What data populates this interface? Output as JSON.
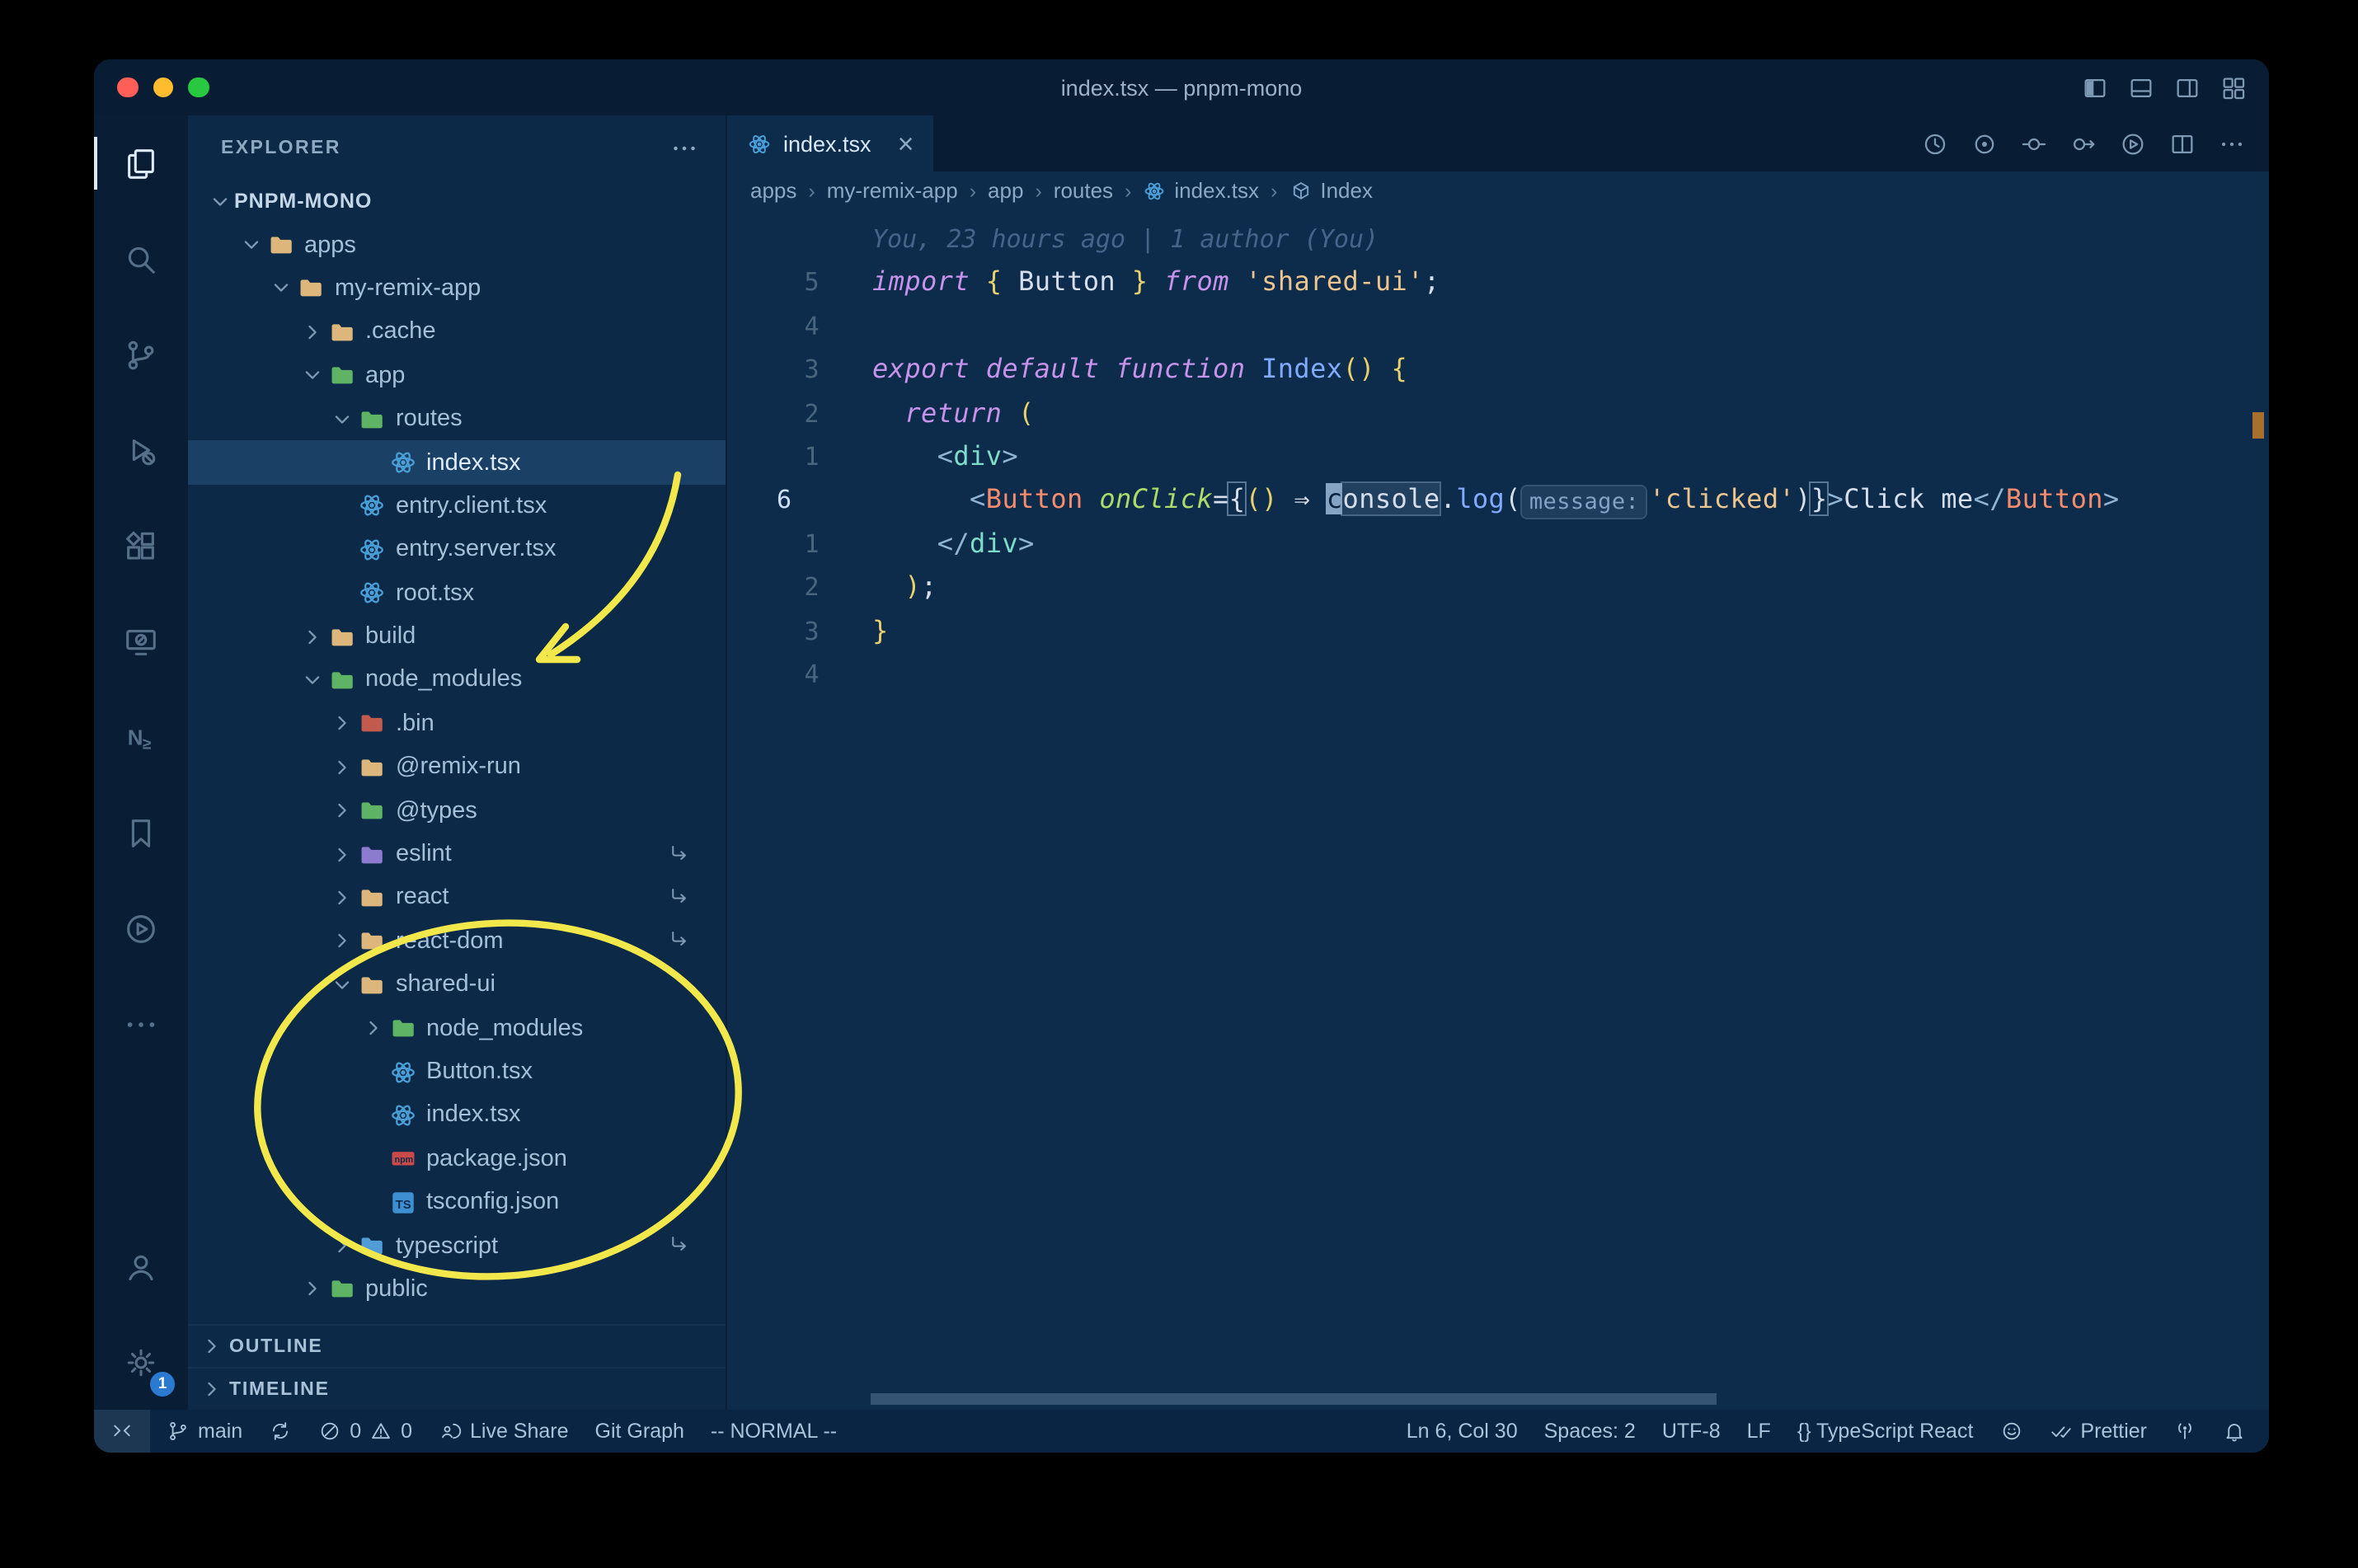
{
  "window": {
    "title": "index.tsx — pnpm-mono"
  },
  "titlebar_controls": [
    {
      "name": "toggle-primary-sidebar",
      "icon": "layoutLeft"
    },
    {
      "name": "toggle-panel",
      "icon": "layoutBottom"
    },
    {
      "name": "toggle-secondary-sidebar",
      "icon": "layoutRight"
    },
    {
      "name": "customize-layout",
      "icon": "layoutGrid"
    }
  ],
  "activity_bar": {
    "top": [
      {
        "name": "explorer",
        "icon": "files",
        "active": true
      },
      {
        "name": "search",
        "icon": "search"
      },
      {
        "name": "source-control",
        "icon": "scm"
      },
      {
        "name": "run-debug",
        "icon": "debug"
      },
      {
        "name": "extensions",
        "icon": "extensions"
      },
      {
        "name": "remote-explorer",
        "icon": "monitor"
      },
      {
        "name": "nx-console",
        "icon": "nx"
      },
      {
        "name": "bookmarks",
        "icon": "bookmark"
      },
      {
        "name": "live-share",
        "icon": "playcircle"
      },
      {
        "name": "more-views",
        "icon": "more"
      }
    ],
    "bottom": [
      {
        "name": "accounts",
        "icon": "account"
      },
      {
        "name": "settings",
        "icon": "gear",
        "badge": "1"
      }
    ]
  },
  "explorer": {
    "header": "EXPLORER",
    "sections": [
      "OUTLINE",
      "TIMELINE"
    ],
    "rows": [
      {
        "label": "PNPM-MONO",
        "level": 0,
        "chevron": "down",
        "root": true
      },
      {
        "label": "apps",
        "level": 1,
        "chevron": "down",
        "icon": "folder",
        "color": "tan"
      },
      {
        "label": "my-remix-app",
        "level": 2,
        "chevron": "down",
        "icon": "folder",
        "color": "tan"
      },
      {
        "label": ".cache",
        "level": 3,
        "chevron": "right",
        "icon": "folder",
        "color": "tan"
      },
      {
        "label": "app",
        "level": 3,
        "chevron": "down",
        "icon": "folder",
        "color": "green"
      },
      {
        "label": "routes",
        "level": 4,
        "chevron": "down",
        "icon": "folder",
        "color": "green"
      },
      {
        "label": "index.tsx",
        "level": 5,
        "chevron": "none",
        "icon": "react",
        "selected": true
      },
      {
        "label": "entry.client.tsx",
        "level": 4,
        "chevron": "none",
        "icon": "react"
      },
      {
        "label": "entry.server.tsx",
        "level": 4,
        "chevron": "none",
        "icon": "react"
      },
      {
        "label": "root.tsx",
        "level": 4,
        "chevron": "none",
        "icon": "react"
      },
      {
        "label": "build",
        "level": 3,
        "chevron": "right",
        "icon": "folder",
        "color": "tan"
      },
      {
        "label": "node_modules",
        "level": 3,
        "chevron": "down",
        "icon": "folder",
        "color": "green"
      },
      {
        "label": ".bin",
        "level": 4,
        "chevron": "right",
        "icon": "folder",
        "color": "red"
      },
      {
        "label": "@remix-run",
        "level": 4,
        "chevron": "right",
        "icon": "folder",
        "color": "tan"
      },
      {
        "label": "@types",
        "level": 4,
        "chevron": "right",
        "icon": "folder",
        "color": "green"
      },
      {
        "label": "eslint",
        "level": 4,
        "chevron": "right",
        "icon": "folder",
        "color": "purple",
        "symlink": true
      },
      {
        "label": "react",
        "level": 4,
        "chevron": "right",
        "icon": "folder",
        "color": "tan",
        "symlink": true
      },
      {
        "label": "react-dom",
        "level": 4,
        "chevron": "right",
        "icon": "folder",
        "color": "tan",
        "symlink": true
      },
      {
        "label": "shared-ui",
        "level": 4,
        "chevron": "down",
        "icon": "folder",
        "color": "tan"
      },
      {
        "label": "node_modules",
        "level": 5,
        "chevron": "right",
        "icon": "folder",
        "color": "green"
      },
      {
        "label": "Button.tsx",
        "level": 5,
        "chevron": "none",
        "icon": "react"
      },
      {
        "label": "index.tsx",
        "level": 5,
        "chevron": "none",
        "icon": "react"
      },
      {
        "label": "package.json",
        "level": 5,
        "chevron": "none",
        "icon": "npm"
      },
      {
        "label": "tsconfig.json",
        "level": 5,
        "chevron": "none",
        "icon": "ts"
      },
      {
        "label": "typescript",
        "level": 4,
        "chevron": "right",
        "icon": "folder",
        "color": "blue",
        "symlink": true
      },
      {
        "label": "public",
        "level": 3,
        "chevron": "right",
        "icon": "folder",
        "color": "green"
      }
    ]
  },
  "tabs": [
    {
      "label": "index.tsx",
      "icon": "react",
      "active": true
    }
  ],
  "editor_actions": [
    {
      "name": "timeline-history",
      "icon": "clockHistory"
    },
    {
      "name": "gitlens-blame",
      "icon": "eyeCircle"
    },
    {
      "name": "open-changes",
      "icon": "circleDash"
    },
    {
      "name": "open-next-change",
      "icon": "circleArrow"
    },
    {
      "name": "run-file",
      "icon": "playcircle"
    },
    {
      "name": "split-editor",
      "icon": "splitEditor"
    },
    {
      "name": "more-actions",
      "icon": "more"
    }
  ],
  "breadcrumbs": [
    {
      "text": "apps"
    },
    {
      "text": "my-remix-app"
    },
    {
      "text": "app"
    },
    {
      "text": "routes"
    },
    {
      "text": "index.tsx",
      "icon": "react"
    },
    {
      "text": "Index",
      "icon": "cube"
    }
  ],
  "editor": {
    "blame": "You, 23 hours ago | 1 author (You)",
    "lines": [
      {
        "num": "5",
        "tokens": [
          {
            "t": "import",
            "c": "keyword",
            "i": true
          },
          {
            "t": " "
          },
          {
            "t": "{",
            "c": "bracket"
          },
          {
            "t": " "
          },
          {
            "t": "Button"
          },
          {
            "t": " "
          },
          {
            "t": "}",
            "c": "bracket"
          },
          {
            "t": " "
          },
          {
            "t": "from",
            "c": "keyword",
            "i": true
          },
          {
            "t": " "
          },
          {
            "t": "'shared-ui'",
            "c": "string"
          },
          {
            "t": ";"
          }
        ]
      },
      {
        "num": "4",
        "tokens": []
      },
      {
        "num": "3",
        "tokens": [
          {
            "t": "export",
            "c": "keyword",
            "i": true
          },
          {
            "t": " "
          },
          {
            "t": "default",
            "c": "keyword",
            "i": true
          },
          {
            "t": " "
          },
          {
            "t": "function",
            "c": "keyword",
            "i": true
          },
          {
            "t": " "
          },
          {
            "t": "Index",
            "c": "function"
          },
          {
            "t": "()",
            "c": "bracket"
          },
          {
            "t": " "
          },
          {
            "t": "{",
            "c": "bracket"
          }
        ]
      },
      {
        "num": "2",
        "tokens": [
          {
            "t": "  "
          },
          {
            "t": "return",
            "c": "keyword",
            "i": true
          },
          {
            "t": " "
          },
          {
            "t": "(",
            "c": "bracket"
          }
        ]
      },
      {
        "num": "1",
        "tokens": [
          {
            "t": "    "
          },
          {
            "t": "<",
            "c": "punct"
          },
          {
            "t": "div",
            "c": "tag"
          },
          {
            "t": ">",
            "c": "punct"
          }
        ]
      },
      {
        "num": "6",
        "current": true,
        "tokens": [
          {
            "t": "      "
          },
          {
            "t": "<",
            "c": "punct"
          },
          {
            "t": "Button",
            "c": "component"
          },
          {
            "t": " "
          },
          {
            "t": "onClick",
            "c": "attr",
            "i": true
          },
          {
            "t": "="
          },
          {
            "t": "{",
            "box": true
          },
          {
            "t": "()",
            "c": "bracket"
          },
          {
            "t": " "
          },
          {
            "t": "⇒"
          },
          {
            "t": " "
          },
          {
            "t": "c",
            "cursor": true
          },
          {
            "t": "onsole",
            "hl": true
          },
          {
            "t": "."
          },
          {
            "t": "log",
            "c": "function"
          },
          {
            "t": "("
          },
          {
            "t": "message:",
            "inlay": true
          },
          {
            "t": "'clicked'",
            "c": "string"
          },
          {
            "t": ")"
          },
          {
            "t": "}",
            "box": true
          },
          {
            "t": ">",
            "c": "punct"
          },
          {
            "t": "Click me"
          },
          {
            "t": "</",
            "c": "punct"
          },
          {
            "t": "Button",
            "c": "component"
          },
          {
            "t": ">",
            "c": "punct"
          }
        ]
      },
      {
        "num": "1",
        "tokens": [
          {
            "t": "    "
          },
          {
            "t": "</",
            "c": "punct"
          },
          {
            "t": "div",
            "c": "tag"
          },
          {
            "t": ">",
            "c": "punct"
          }
        ]
      },
      {
        "num": "2",
        "tokens": [
          {
            "t": "  "
          },
          {
            "t": ")",
            "c": "bracket"
          },
          {
            "t": ";"
          }
        ]
      },
      {
        "num": "3",
        "tokens": [
          {
            "t": "}",
            "c": "bracket"
          }
        ]
      },
      {
        "num": "4",
        "tokens": []
      }
    ]
  },
  "status_bar": {
    "left": [
      {
        "name": "remote-indicator",
        "accent": true,
        "parts": [
          {
            "icon": "remote"
          }
        ]
      },
      {
        "name": "git-branch",
        "parts": [
          {
            "icon": "branch"
          },
          {
            "text": "main"
          }
        ]
      },
      {
        "name": "sync",
        "parts": [
          {
            "icon": "sync"
          }
        ]
      },
      {
        "name": "problems",
        "parts": [
          {
            "icon": "error"
          },
          {
            "text": "0"
          },
          {
            "icon": "warn"
          },
          {
            "text": "0"
          }
        ]
      },
      {
        "name": "live-share",
        "parts": [
          {
            "icon": "liveshare"
          },
          {
            "text": "Live Share"
          }
        ]
      },
      {
        "name": "git-graph",
        "parts": [
          {
            "text": "Git Graph"
          }
        ]
      },
      {
        "name": "vim-mode",
        "parts": [
          {
            "text": "-- NORMAL --"
          }
        ]
      }
    ],
    "right": [
      {
        "name": "cursor-position",
        "parts": [
          {
            "text": "Ln 6, Col 30"
          }
        ]
      },
      {
        "name": "indentation",
        "parts": [
          {
            "text": "Spaces: 2"
          }
        ]
      },
      {
        "name": "encoding",
        "parts": [
          {
            "text": "UTF-8"
          }
        ]
      },
      {
        "name": "eol",
        "parts": [
          {
            "text": "LF"
          }
        ]
      },
      {
        "name": "language-mode",
        "parts": [
          {
            "text": "{} TypeScript React"
          }
        ]
      },
      {
        "name": "feedback",
        "parts": [
          {
            "icon": "smiley"
          }
        ]
      },
      {
        "name": "prettier",
        "parts": [
          {
            "icon": "dblcheck"
          },
          {
            "text": "Prettier"
          }
        ]
      },
      {
        "name": "screencast",
        "parts": [
          {
            "icon": "broadcast"
          }
        ]
      },
      {
        "name": "notifications",
        "parts": [
          {
            "icon": "bell"
          }
        ]
      }
    ]
  },
  "colors": {
    "annotation_yellow": "#f2e84b",
    "traffic": {
      "close": "#ff5f57",
      "minimize": "#febc2e",
      "zoom": "#28c840"
    },
    "syntax": {
      "keyword": "#c792ea",
      "function": "#82aaff",
      "string": "#ecc48d",
      "text": "#d6deeb",
      "tag": "#7fdbca",
      "component": "#f78c6c",
      "attr": "#addb67",
      "bracket": "#e8d16c",
      "punct": "#8fb5d1",
      "comment": "#46648a"
    },
    "folders": {
      "tan": "#dcb67a",
      "green": "#5fb365",
      "red": "#c25b4e",
      "purple": "#8d7ad1",
      "blue": "#4f9cd6"
    },
    "file_icons": {
      "react": "#4a9fd8",
      "npm": "#cb4a48",
      "ts": "#3d8fd1"
    }
  }
}
